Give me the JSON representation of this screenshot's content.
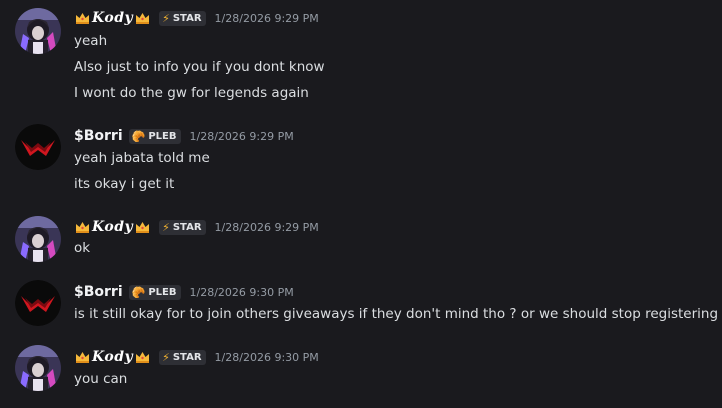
{
  "users": {
    "kody": {
      "name": "Kody",
      "tag": "STAR",
      "crown_icon": "crown-icon",
      "tag_icon": "lightning-bolt-icon"
    },
    "borri": {
      "name": "$Borri",
      "tag": "PLEB",
      "tag_icon": "leaf-icon"
    }
  },
  "messages": [
    {
      "author": "kody",
      "timestamp": "1/28/2026 9:29 PM",
      "lines": [
        "yeah",
        "Also just to info you if you dont know",
        "I wont do the gw for legends again"
      ]
    },
    {
      "author": "borri",
      "timestamp": "1/28/2026 9:29 PM",
      "lines": [
        "yeah jabata told me",
        "its okay i get it"
      ]
    },
    {
      "author": "kody",
      "timestamp": "1/28/2026 9:29 PM",
      "lines": [
        "ok"
      ]
    },
    {
      "author": "borri",
      "timestamp": "1/28/2026 9:30 PM",
      "lines": [
        "is it still okay for to join others giveaways if they don't mind tho ? or we should stop registering"
      ]
    },
    {
      "author": "kody",
      "timestamp": "1/28/2026 9:30 PM",
      "lines": [
        "you can"
      ]
    }
  ],
  "colors": {
    "background": "#1a1a1e",
    "text": "#dbdee1",
    "timestamp": "#949ba4",
    "tag_bg": "#2e2f35",
    "bolt": "#f0b232",
    "borri_avatar_red": "#d0161f"
  }
}
